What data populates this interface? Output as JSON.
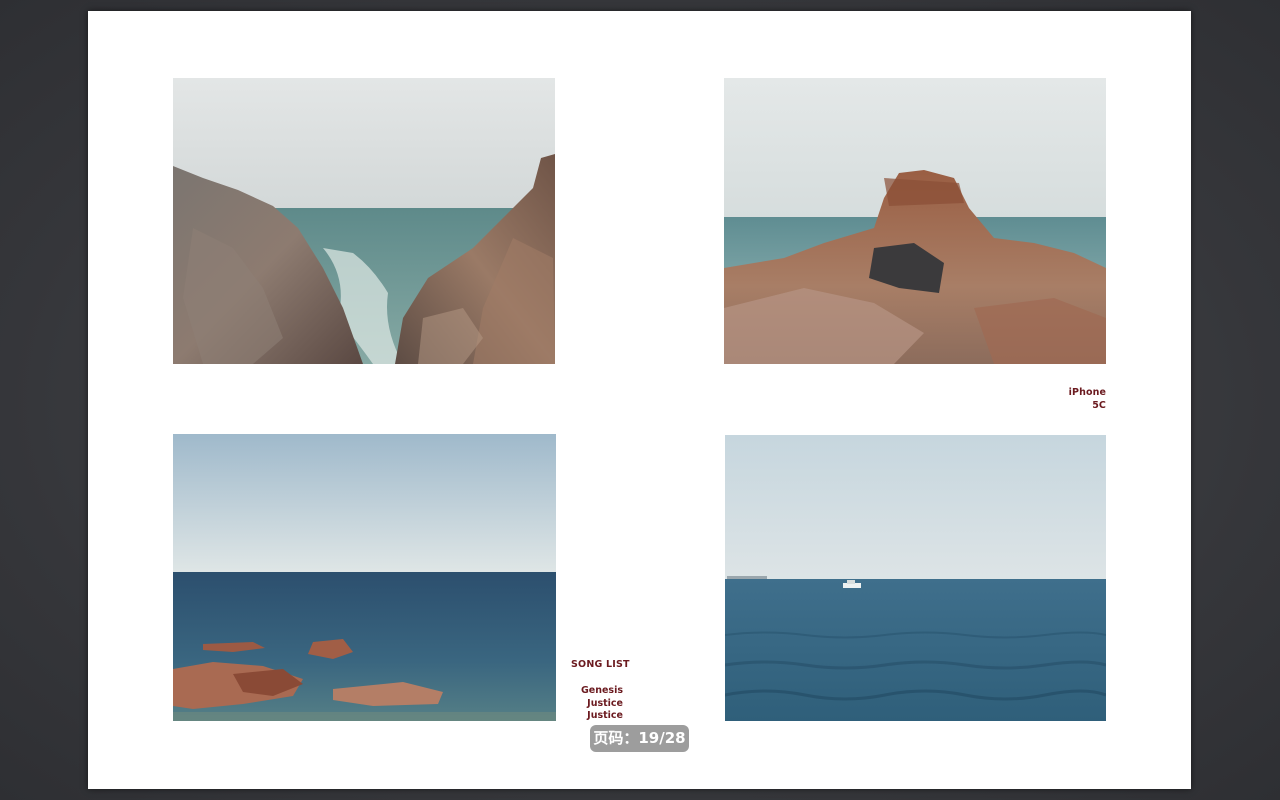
{
  "page": {
    "caption": {
      "line1": "iPhone",
      "line2": "5C"
    },
    "song_list": {
      "title": "SONG LIST",
      "items": [
        "Genesis",
        "Justice",
        "Justice"
      ]
    }
  },
  "photos": [
    {
      "name": "photo-rocky-cove",
      "subject": "rocky cove with waves"
    },
    {
      "name": "photo-rock-formation",
      "subject": "red rock formation by the sea"
    },
    {
      "name": "photo-sea-with-rocks",
      "subject": "calm sea with rocks in foreground"
    },
    {
      "name": "photo-open-sea-boat",
      "subject": "open sea with a small boat"
    }
  ],
  "viewer": {
    "page_indicator": "页码：19/28"
  },
  "colors": {
    "accent_text": "#6b1a1f",
    "background": "#3a3b3f",
    "page": "#ffffff"
  }
}
